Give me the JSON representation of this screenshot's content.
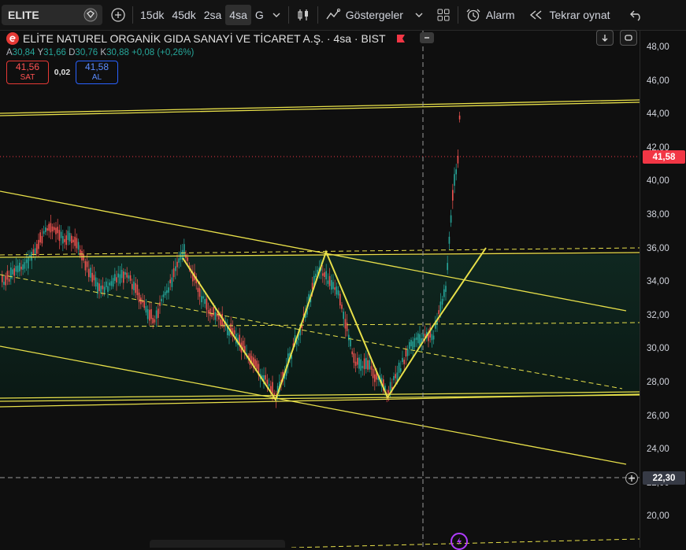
{
  "toolbar": {
    "symbol": "ELITE",
    "intervals": [
      "15dk",
      "45dk",
      "2sa",
      "4sa",
      "G"
    ],
    "active_interval": "4sa",
    "indicators_label": "Göstergeler",
    "alarm_label": "Alarm",
    "replay_label": "Tekrar oynat"
  },
  "legend": {
    "title": "ELİTE NATUREL ORGANİK GIDA SANAYİ VE TİCARET A.Ş. · 4sa · BIST",
    "ohlc": [
      {
        "k": "A",
        "v": "30,84"
      },
      {
        "k": "Y",
        "v": "31,66"
      },
      {
        "k": "D",
        "v": "30,76"
      },
      {
        "k": "K",
        "v": "30,88"
      }
    ],
    "change": "+0,08 (+0,26%)",
    "sell_price": "41,56",
    "sell_label": "SAT",
    "spread": "0,02",
    "buy_price": "41,58",
    "buy_label": "AL"
  },
  "price_axis": {
    "ticks": [
      "48,00",
      "46,00",
      "44,00",
      "42,00",
      "40,00",
      "38,00",
      "36,00",
      "34,00",
      "32,00",
      "30,00",
      "28,00",
      "26,00",
      "24,00",
      "22,00",
      "20,00"
    ],
    "current_price": "41,58",
    "crosshair_price": "22,30"
  },
  "colors": {
    "up": "#26a69a",
    "down": "#ef5350",
    "drawing": "#e8e04a",
    "price_tag": "#f23645"
  },
  "icons": {
    "symbol_search": "symbol-search-icon",
    "add_symbol": "plus-circle-icon",
    "chart_type": "candles-icon",
    "indicators": "indicators-icon",
    "layout": "grid-icon",
    "alarm": "alarm-clock-icon",
    "replay": "rewind-icon",
    "undo": "undo-icon"
  }
}
